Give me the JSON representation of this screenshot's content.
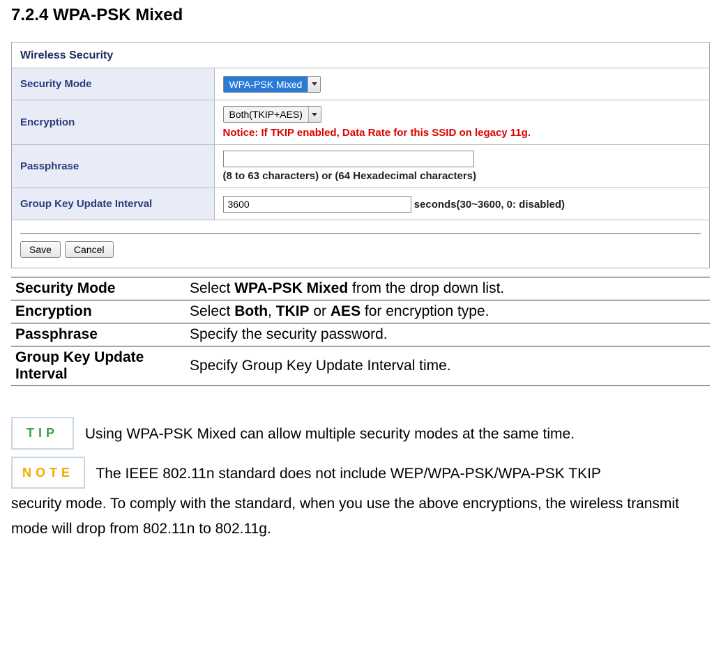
{
  "heading": "7.2.4 WPA-PSK Mixed",
  "panel": {
    "title": "Wireless Security",
    "rows": {
      "security_mode": {
        "label": "Security Mode",
        "value": "WPA-PSK Mixed"
      },
      "encryption": {
        "label": "Encryption",
        "value": "Both(TKIP+AES)",
        "notice": "Notice: If TKIP enabled, Data Rate for this SSID on legacy 11g."
      },
      "passphrase": {
        "label": "Passphrase",
        "value": "",
        "hint": "(8 to 63 characters) or (64 Hexadecimal characters)"
      },
      "group_key": {
        "label": "Group Key Update Interval",
        "value": "3600",
        "suffix": "seconds(30~3600, 0: disabled)"
      }
    },
    "buttons": {
      "save": "Save",
      "cancel": "Cancel"
    }
  },
  "desc": {
    "security_mode": {
      "label": "Security Mode",
      "pre": "Select ",
      "b1": "WPA-PSK Mixed",
      "post": " from the drop down list."
    },
    "encryption": {
      "label": "Encryption",
      "pre": "Select ",
      "b1": "Both",
      "mid1": ", ",
      "b2": "TKIP",
      "mid2": " or ",
      "b3": "AES",
      "post": " for encryption type."
    },
    "passphrase": {
      "label": "Passphrase",
      "text": "Specify the security password."
    },
    "group_key": {
      "label": "Group Key Update Interval",
      "text": "Specify Group Key Update Interval time."
    }
  },
  "notes": {
    "tip_badge": "TIP",
    "tip_text": "Using WPA-PSK Mixed can allow multiple security modes at the same time.",
    "note_badge": "NOTE",
    "note_text_1": "The IEEE 802.11n standard does not include WEP/WPA-PSK/WPA-PSK TKIP ",
    "note_text_2": "security mode. To comply with the standard, when you use the above encryptions, the wireless transmit mode will drop from 802.11n to 802.11g."
  }
}
